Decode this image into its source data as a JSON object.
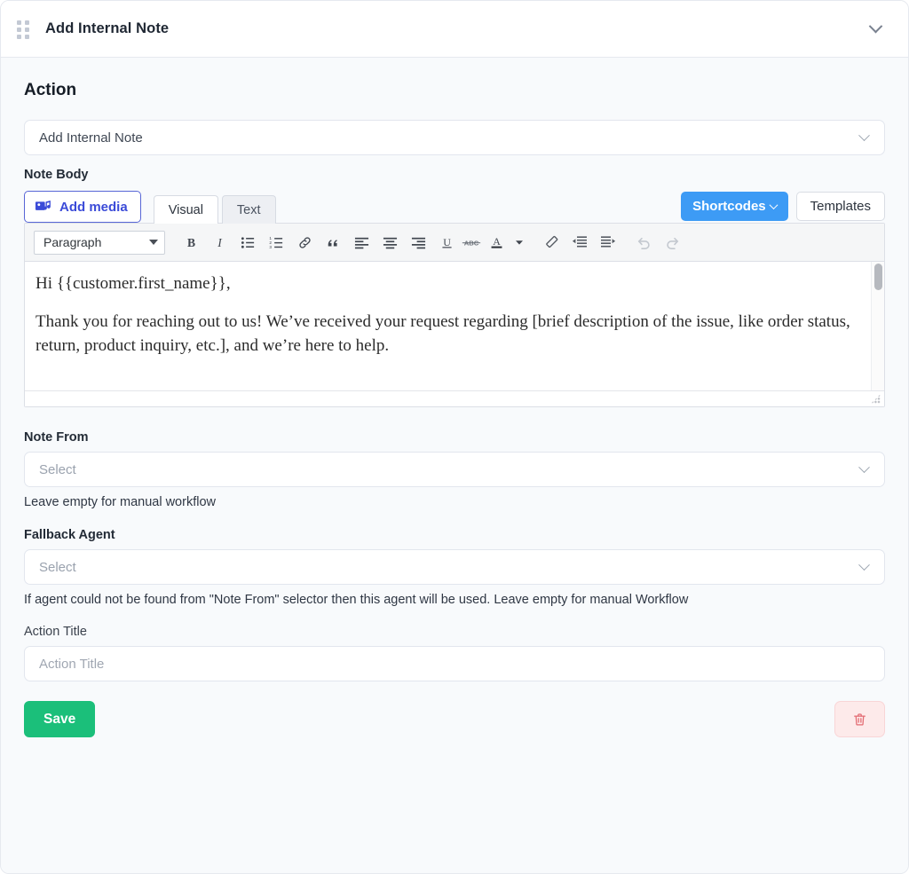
{
  "header": {
    "title": "Add Internal Note",
    "drag_handle_icon": "drag-handle-icon",
    "collapse_icon": "chevron-down-icon"
  },
  "action_section": {
    "title": "Action",
    "action_select": {
      "value": "Add Internal Note",
      "chevron_icon": "chevron-down-icon"
    }
  },
  "note_body": {
    "label": "Note Body",
    "add_media_label": "Add media",
    "add_media_icon": "media-icon",
    "tabs": [
      {
        "label": "Visual",
        "active": true
      },
      {
        "label": "Text",
        "active": false
      }
    ],
    "shortcodes_label": "Shortcodes",
    "shortcodes_chevron_icon": "chevron-down-icon",
    "templates_label": "Templates",
    "toolbar": {
      "format_select_value": "Paragraph",
      "buttons": [
        "bold-icon",
        "italic-icon",
        "bulleted-list-icon",
        "numbered-list-icon",
        "link-icon",
        "blockquote-icon",
        "align-left-icon",
        "align-center-icon",
        "align-right-icon",
        "underline-icon",
        "strikethrough-icon",
        "text-color-icon",
        "text-color-dropdown-icon",
        "clear-formatting-icon",
        "outdent-icon",
        "indent-icon",
        "undo-icon",
        "redo-icon"
      ],
      "strikethrough_label": "ABC"
    },
    "content": {
      "paragraph_1": "Hi {{customer.first_name}},",
      "paragraph_2": "Thank you for reaching out to us! We’ve received your request regarding [brief description of the issue, like order status, return, product inquiry, etc.], and we’re here to help."
    }
  },
  "note_from": {
    "label": "Note From",
    "placeholder": "Select",
    "help": "Leave empty for manual workflow",
    "chevron_icon": "chevron-down-icon"
  },
  "fallback_agent": {
    "label": "Fallback Agent",
    "placeholder": "Select",
    "help": "If agent could not be found from \"Note From\" selector then this agent will be used. Leave empty for manual Workflow",
    "chevron_icon": "chevron-down-icon"
  },
  "action_title": {
    "label": "Action Title",
    "placeholder": "Action Title"
  },
  "footer": {
    "save_label": "Save",
    "delete_icon": "trash-icon"
  },
  "colors": {
    "accent_blue": "#3d9bf5",
    "media_blue": "#3b4bd8",
    "save_green": "#1bbf7a",
    "delete_pink_bg": "#fdeaea",
    "delete_pink_border": "#f9d5d7",
    "delete_icon": "#e36b72",
    "page_bg": "#f8fafc",
    "border": "#e6e9ef"
  }
}
